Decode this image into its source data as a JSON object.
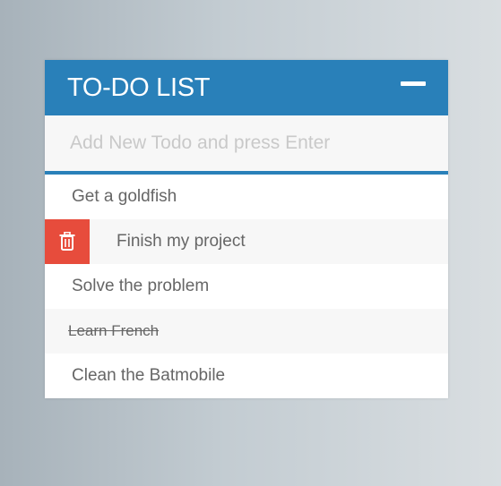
{
  "header": {
    "title": "TO-DO LIST",
    "toggle_icon": "minus-icon"
  },
  "new_todo": {
    "placeholder": "Add New Todo and press Enter",
    "value": ""
  },
  "todos": [
    {
      "text": "Get a goldfish",
      "completed": false,
      "hovered": false
    },
    {
      "text": "Finish my project",
      "completed": false,
      "hovered": true,
      "delete_icon": "trash-icon"
    },
    {
      "text": "Solve the problem",
      "completed": false,
      "hovered": false
    },
    {
      "text": "Learn French",
      "completed": true,
      "hovered": false
    },
    {
      "text": "Clean the Batmobile",
      "completed": false,
      "hovered": false
    }
  ],
  "colors": {
    "accent": "#2980b9",
    "delete": "#e74c3c",
    "text": "#666666",
    "placeholder": "#c9c9c9"
  }
}
